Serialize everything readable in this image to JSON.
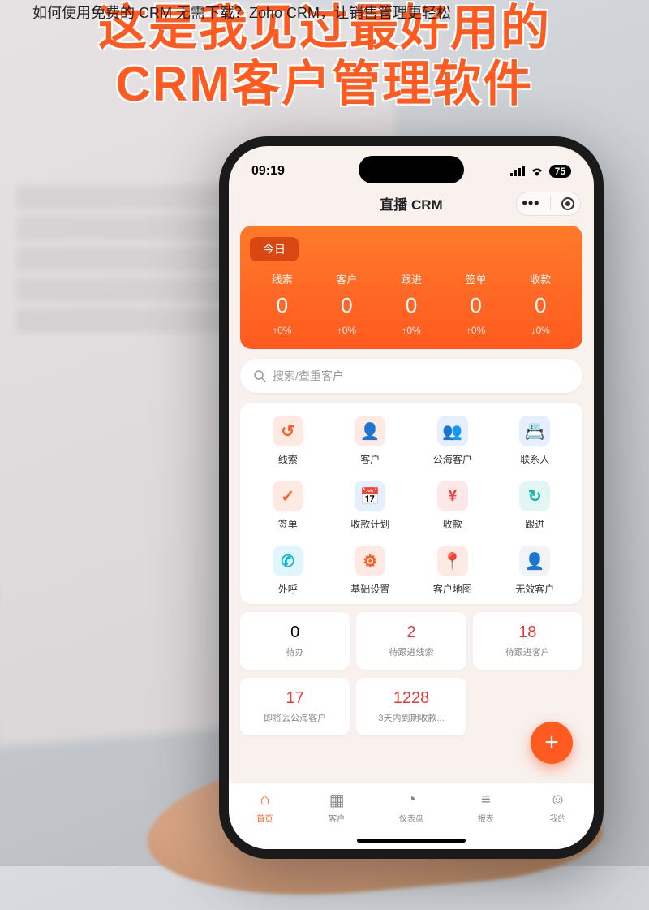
{
  "caption": "如何使用免费的 CRM 无需下载？Zoho CRM，让销售管理更轻松",
  "headline": {
    "line1": "这是我见过最好用的",
    "line2": "CRM客户管理软件"
  },
  "statusbar": {
    "time": "09:19",
    "battery": "75"
  },
  "app": {
    "title": "直播 CRM"
  },
  "dashboard": {
    "tab": "今日",
    "stats": [
      {
        "label": "线索",
        "value": "0",
        "delta": "↑0%"
      },
      {
        "label": "客户",
        "value": "0",
        "delta": "↑0%"
      },
      {
        "label": "跟进",
        "value": "0",
        "delta": "↑0%"
      },
      {
        "label": "签单",
        "value": "0",
        "delta": "↑0%"
      },
      {
        "label": "收款",
        "value": "0",
        "delta": "↓0%"
      }
    ]
  },
  "search": {
    "placeholder": "搜索/查重客户"
  },
  "grid": [
    {
      "label": "线索",
      "color": "#ff5a1f",
      "glyph": "↺"
    },
    {
      "label": "客户",
      "color": "#ff5a1f",
      "glyph": "👤"
    },
    {
      "label": "公海客户",
      "color": "#3b82f6",
      "glyph": "👥"
    },
    {
      "label": "联系人",
      "color": "#3b82f6",
      "glyph": "📇"
    },
    {
      "label": "签单",
      "color": "#ff5a1f",
      "glyph": "✓"
    },
    {
      "label": "收款计划",
      "color": "#3b82f6",
      "glyph": "📅"
    },
    {
      "label": "收款",
      "color": "#ef4444",
      "glyph": "¥"
    },
    {
      "label": "跟进",
      "color": "#14b8a6",
      "glyph": "↻"
    },
    {
      "label": "外呼",
      "color": "#06b6d4",
      "glyph": "✆"
    },
    {
      "label": "基础设置",
      "color": "#ff5a1f",
      "glyph": "⚙"
    },
    {
      "label": "客户地图",
      "color": "#ff5a1f",
      "glyph": "📍"
    },
    {
      "label": "无效客户",
      "color": "#94a3b8",
      "glyph": "👤"
    }
  ],
  "counters": {
    "row1": [
      {
        "num": "0",
        "label": "待办",
        "red": false
      },
      {
        "num": "2",
        "label": "待跟进线索",
        "red": true
      },
      {
        "num": "18",
        "label": "待跟进客户",
        "red": true
      }
    ],
    "row2": [
      {
        "num": "17",
        "label": "即将丢公海客户",
        "red": true
      },
      {
        "num": "1228",
        "label": "3天内到期收款...",
        "red": true
      }
    ]
  },
  "fab": "+",
  "nav": [
    {
      "label": "首页",
      "glyph": "⌂",
      "active": true
    },
    {
      "label": "客户",
      "glyph": "▦",
      "active": false
    },
    {
      "label": "仪表盘",
      "glyph": "◔",
      "active": false
    },
    {
      "label": "报表",
      "glyph": "≡",
      "active": false
    },
    {
      "label": "我的",
      "glyph": "☺",
      "active": false
    }
  ]
}
